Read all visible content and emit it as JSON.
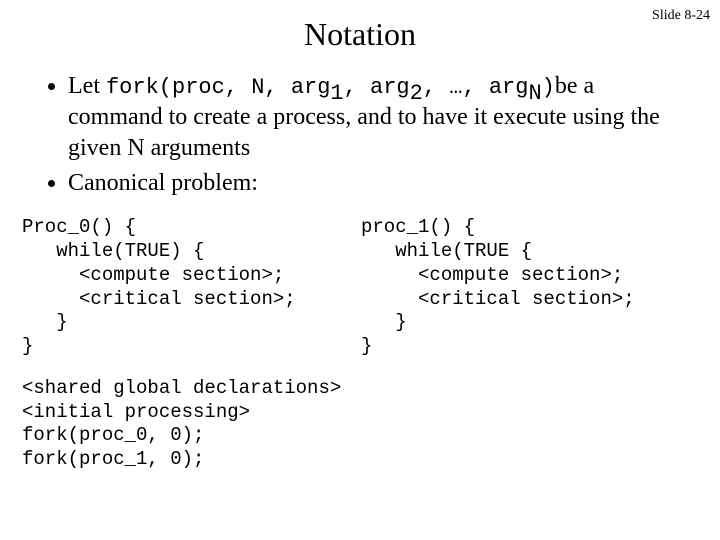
{
  "slide_number": "Slide 8-24",
  "title": "Notation",
  "bullet1": {
    "t1": "Let ",
    "code1": "fork(proc, N, arg",
    "sub1": "1",
    "code2": ", arg",
    "sub2": "2",
    "code3": ", …, arg",
    "sub3": "N",
    "code4": ")",
    "t2": "be a command to create a process, and to have it execute using the given N arguments"
  },
  "bullet2": "Canonical problem:",
  "code_left": "Proc_0() {\n   while(TRUE) {\n     <compute section>;\n     <critical section>;\n   }\n}",
  "code_right": "proc_1() {\n   while(TRUE {\n     <compute section>;\n     <critical section>;\n   }\n}",
  "code_bottom": "<shared global declarations>\n<initial processing>\nfork(proc_0, 0);\nfork(proc_1, 0);"
}
